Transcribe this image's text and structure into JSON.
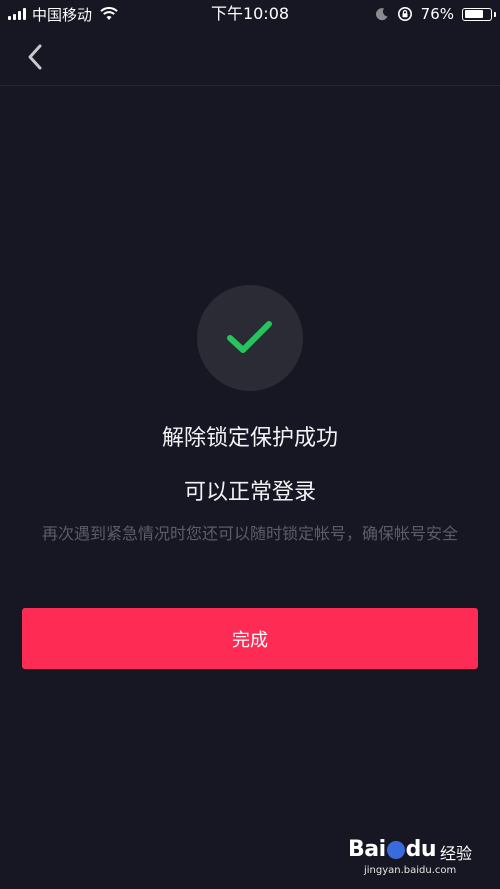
{
  "status_bar": {
    "carrier": "中国移动",
    "time": "下午10:08",
    "battery_percent": "76%",
    "battery_level": 0.76
  },
  "result": {
    "title": "解除锁定保护成功",
    "subtitle": "可以正常登录",
    "description": "再次遇到紧急情况时您还可以随时锁定帐号，确保帐号安全"
  },
  "actions": {
    "done_label": "完成"
  },
  "watermark": {
    "brand": "Bai",
    "brand_suffix": "du",
    "label": "经验",
    "url": "jingyan.baidu.com"
  },
  "colors": {
    "background": "#161722",
    "accent": "#fe2c55",
    "success": "#25c45d"
  },
  "icons": [
    "back-arrow",
    "checkmark",
    "wifi",
    "moon",
    "orientation-lock",
    "battery"
  ]
}
